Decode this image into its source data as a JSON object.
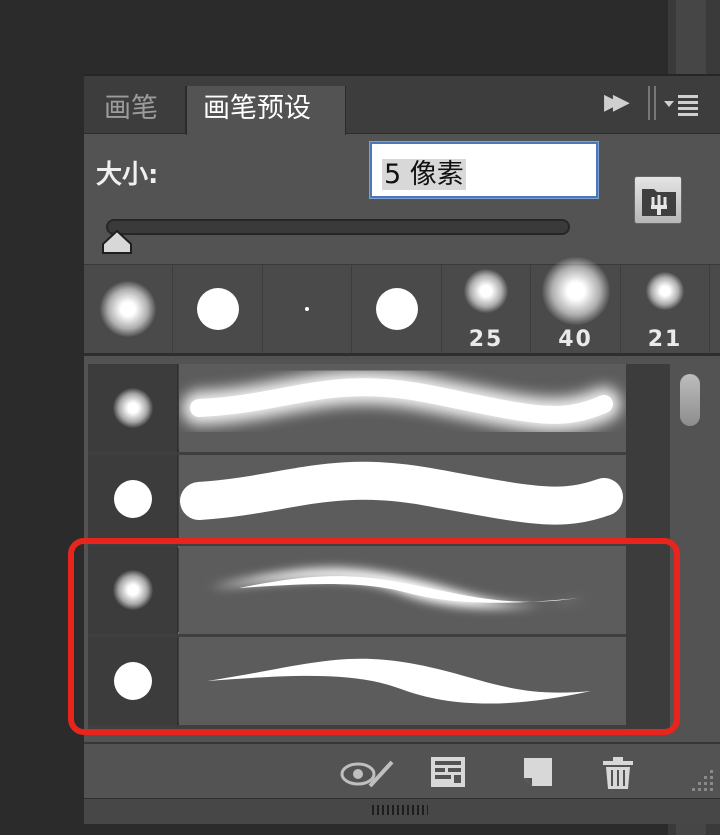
{
  "tabs": [
    {
      "label": "画笔"
    },
    {
      "label": "画笔预设"
    }
  ],
  "size": {
    "label": "大小:",
    "value": "5 像素"
  },
  "presets": [
    {
      "type": "soft",
      "num": ""
    },
    {
      "type": "hard",
      "num": ""
    },
    {
      "type": "tiny",
      "num": ""
    },
    {
      "type": "hard",
      "num": ""
    },
    {
      "type": "soft",
      "num": "25"
    },
    {
      "type": "soft",
      "num": "40"
    },
    {
      "type": "soft",
      "num": "21"
    }
  ],
  "strokes": [
    {
      "tip": "soft",
      "stroke": "soft-wave"
    },
    {
      "tip": "hard",
      "stroke": "hard-wave"
    },
    {
      "tip": "soft",
      "stroke": "soft-taper",
      "selected": true
    },
    {
      "tip": "hard",
      "stroke": "hard-taper"
    }
  ],
  "icons": {
    "toggle_preview": "eye-brush-icon",
    "panel_menu": "panel-menu-icon",
    "new_preset": "new-preset-icon",
    "delete": "trash-icon",
    "open_brush_panel": "brush-panel-toggle-icon"
  },
  "colors": {
    "highlight": "#e8251c",
    "selection": "#56739c"
  }
}
